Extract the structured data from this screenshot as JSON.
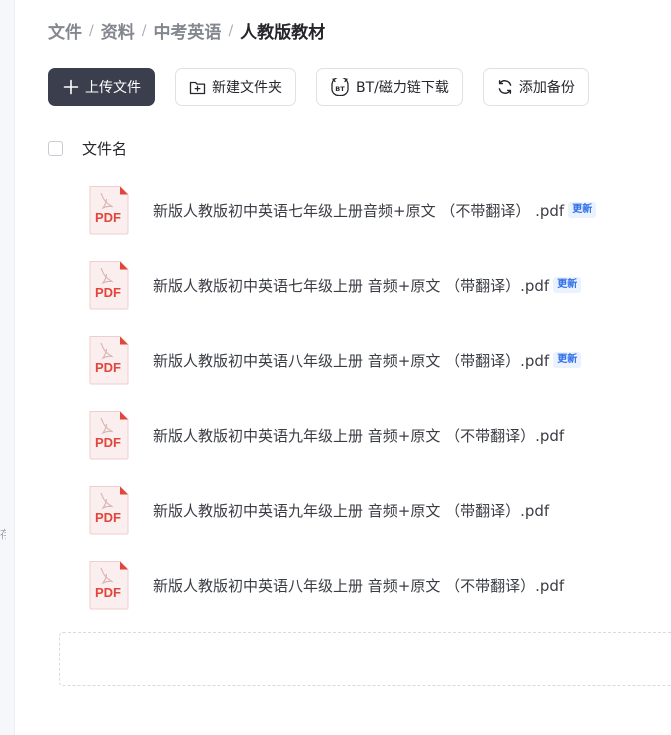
{
  "breadcrumb": {
    "items": [
      "文件",
      "资料",
      "中考英语",
      "人教版教材"
    ],
    "separator": "/"
  },
  "toolbar": {
    "upload_label": "上传文件",
    "new_folder_label": "新建文件夹",
    "bt_label": "BT/磁力链下载",
    "backup_label": "添加备份"
  },
  "list": {
    "header_label": "文件名",
    "file_icon_text": "PDF",
    "files": [
      {
        "name": "新版人教版初中英语七年级上册音频+原文 （不带翻译） .pdf",
        "badge": "更新"
      },
      {
        "name": "新版人教版初中英语七年级上册 音频+原文 （带翻译）.pdf",
        "badge": "更新"
      },
      {
        "name": "新版人教版初中英语八年级上册 音频+原文 （带翻译）.pdf",
        "badge": "更新"
      },
      {
        "name": "新版人教版初中英语九年级上册 音频+原文 （不带翻译）.pdf",
        "badge": ""
      },
      {
        "name": "新版人教版初中英语九年级上册 音频+原文 （带翻译）.pdf",
        "badge": ""
      },
      {
        "name": "新版人教版初中英语八年级上册 音频+原文 （不带翻译）.pdf",
        "badge": ""
      }
    ]
  },
  "colors": {
    "primary_button": "#3b3f4d",
    "badge_text": "#2f6fe8",
    "badge_bg": "#eaf2ff",
    "pdf_red": "#e2453b"
  },
  "icons": {
    "upload": "plus-icon",
    "new_folder": "folder-plus-icon",
    "bt": "bt-magnet-icon",
    "backup": "refresh-icon",
    "file": "pdf-file-icon"
  }
}
